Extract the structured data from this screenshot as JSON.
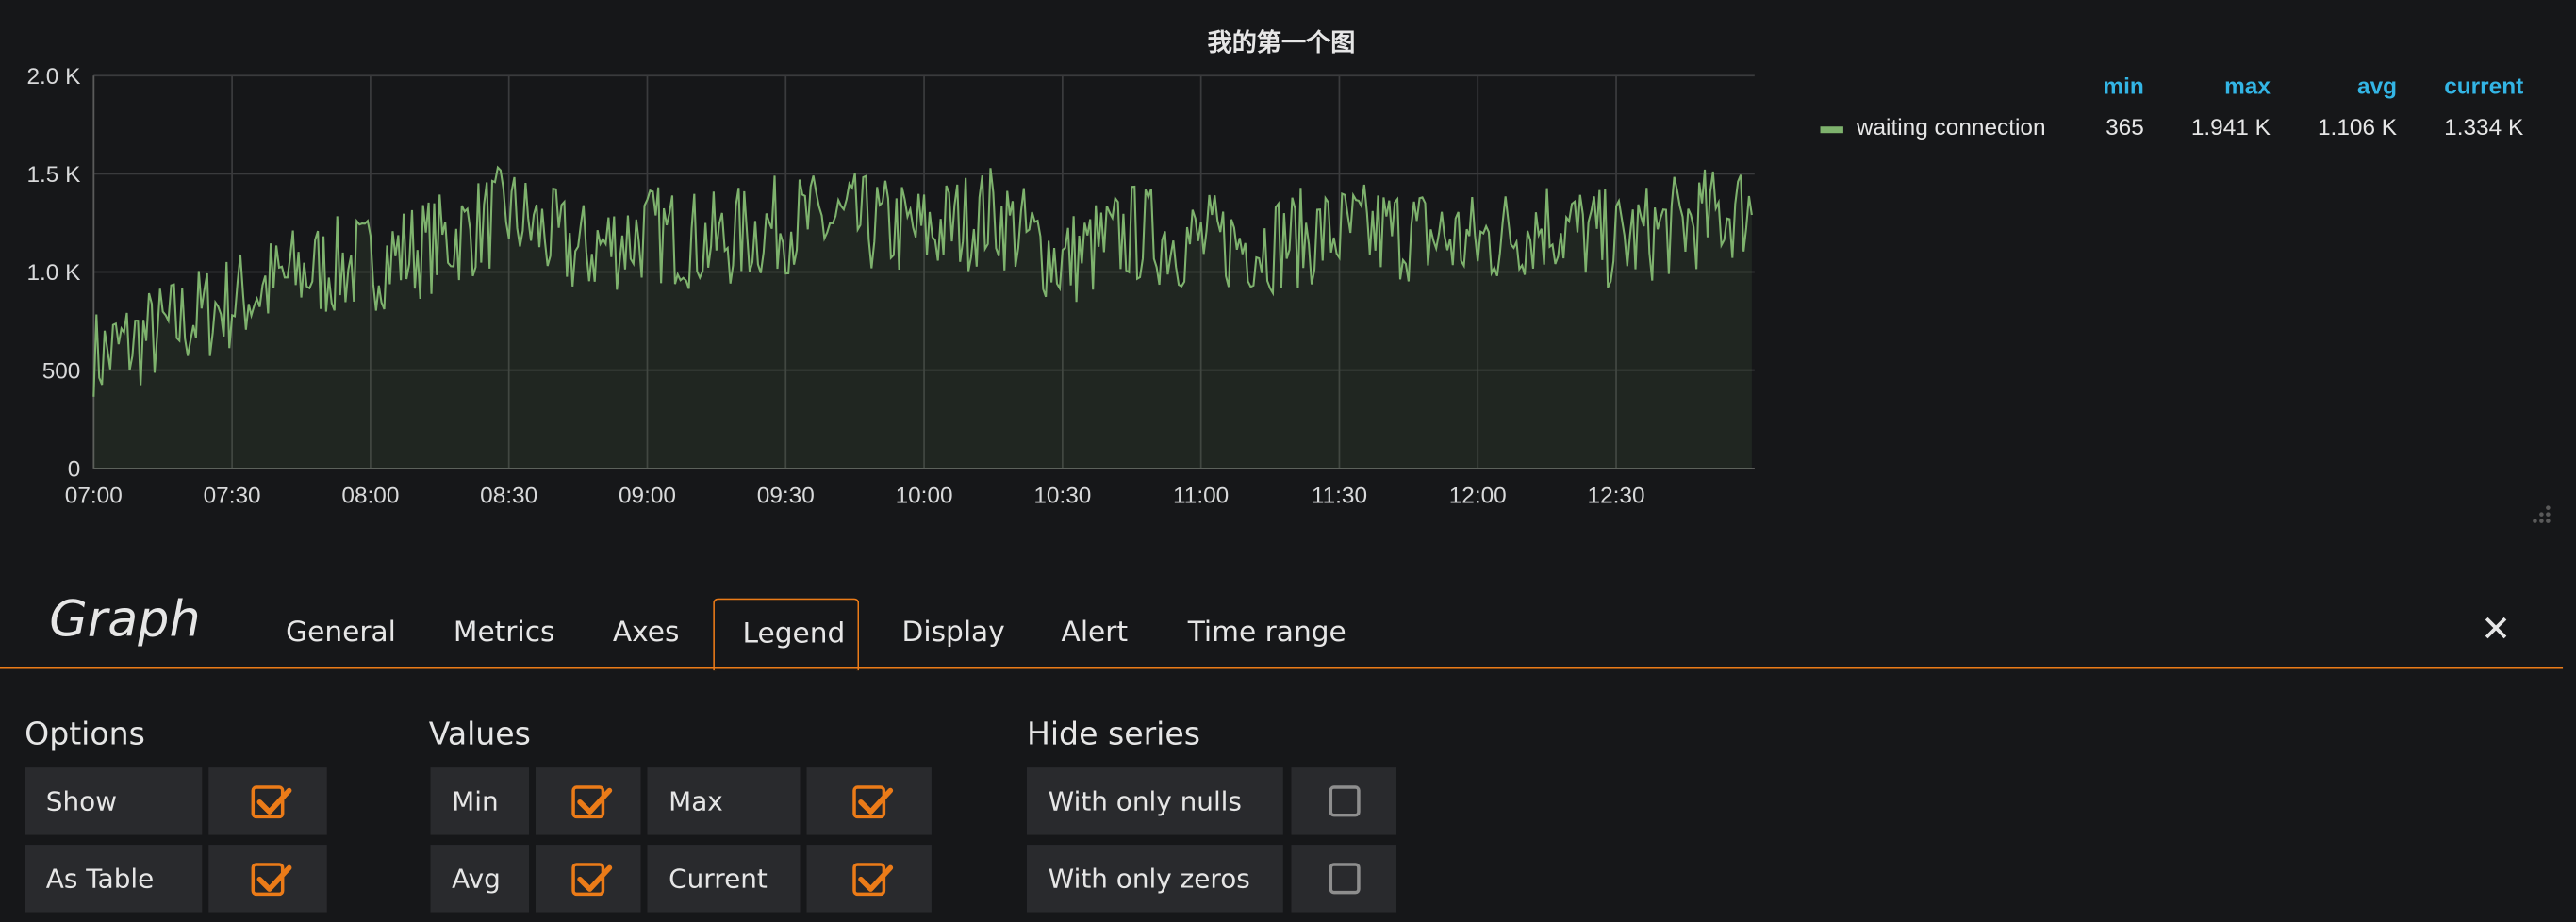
{
  "chart_data": {
    "type": "area",
    "title": "我的第一个图",
    "x_ticks": [
      "07:00",
      "07:30",
      "08:00",
      "08:30",
      "09:00",
      "09:30",
      "10:00",
      "10:30",
      "11:00",
      "11:30",
      "12:00",
      "12:30"
    ],
    "y_ticks": [
      "0",
      "500",
      "1.0 K",
      "1.5 K",
      "2.0 K"
    ],
    "ylim": [
      0,
      2000
    ],
    "xlim": [
      "07:00",
      "13:00"
    ],
    "grid": true,
    "legend_placement": "right",
    "series": [
      {
        "name": "waiting connection",
        "color": "#7eb26d",
        "x": [
          "07:00",
          "07:15",
          "07:30",
          "07:45",
          "08:00",
          "08:15",
          "08:30",
          "08:45",
          "09:00",
          "09:15",
          "09:30",
          "09:45",
          "10:00",
          "10:15",
          "10:30",
          "10:45",
          "11:00",
          "11:15",
          "11:30",
          "11:45",
          "12:00",
          "12:15",
          "12:30",
          "12:45",
          "13:00"
        ],
        "values": [
          560,
          700,
          850,
          1000,
          1050,
          1150,
          1300,
          1100,
          1200,
          1150,
          1250,
          1250,
          1200,
          1300,
          1050,
          1200,
          1150,
          1150,
          1200,
          1200,
          1150,
          1250,
          1150,
          1250,
          1334
        ],
        "stats": {
          "min": "365",
          "max": "1.941 K",
          "avg": "1.106 K",
          "current": "1.334 K"
        }
      }
    ]
  },
  "legend": {
    "headers": [
      "min",
      "max",
      "avg",
      "current"
    ],
    "row": {
      "name": "waiting connection",
      "min": "365",
      "max": "1.941 K",
      "avg": "1.106 K",
      "current": "1.334 K"
    }
  },
  "editor": {
    "title": "Graph",
    "tabs": [
      "General",
      "Metrics",
      "Axes",
      "Legend",
      "Display",
      "Alert",
      "Time range"
    ],
    "active_tab": "Legend",
    "close_icon": "close-icon"
  },
  "options": {
    "title": "Options",
    "show": {
      "label": "Show",
      "checked": true
    },
    "as_table": {
      "label": "As Table",
      "checked": true
    }
  },
  "values": {
    "title": "Values",
    "min": {
      "label": "Min",
      "checked": true
    },
    "max": {
      "label": "Max",
      "checked": true
    },
    "avg": {
      "label": "Avg",
      "checked": true
    },
    "current": {
      "label": "Current",
      "checked": true
    }
  },
  "hide_series": {
    "title": "Hide series",
    "only_nulls": {
      "label": "With only nulls",
      "checked": false
    },
    "only_zeros": {
      "label": "With only zeros",
      "checked": false
    }
  },
  "colors": {
    "accent": "#eb7b18",
    "legend_header": "#33b5e5",
    "series": "#7eb26d"
  }
}
